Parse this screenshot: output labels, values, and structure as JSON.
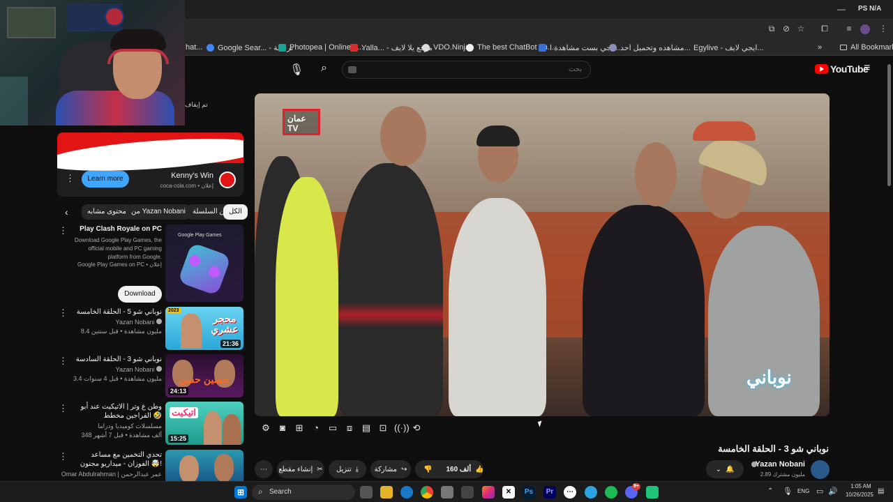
{
  "browser": {
    "bookmarks": [
      {
        "label": "hat..."
      },
      {
        "label": "Google Sear... - ترجمة"
      },
      {
        "label": "Photopea | Online P..."
      },
      {
        "label": "Yalla... - موقع يلا لايف"
      },
      {
        "label": "VDO.Ninja"
      },
      {
        "label": "The best ChatBot an..."
      },
      {
        "label": "ايجي بست مشاهدة ا..."
      },
      {
        "label": "مشاهده وتحميل احد..."
      },
      {
        "label": "Egylive - ايجي لايف..."
      }
    ],
    "all_bookmarks": "All Bookmarks",
    "titlebar_right": "PS N/A"
  },
  "youtube": {
    "logo": "YouTube",
    "search_placeholder": "بحث",
    "stop_text": "تم إيقاف"
  },
  "ad": {
    "advertiser": "Kenny's Win",
    "domain": "coca-cola.com",
    "sponsored": "إعلان",
    "cta": "Learn more"
  },
  "chips": [
    {
      "label": "الكل"
    },
    {
      "label": "من السلسلة"
    },
    {
      "label": "من Yazan Nobani"
    },
    {
      "label": "محتوى مشابه"
    }
  ],
  "promo": {
    "title": "Play Clash Royale on PC",
    "description": "Download Google Play Games, the official mobile and PC gaming platform from Google.",
    "channel": "Google Play Games on PC",
    "sponsored": "إعلان",
    "cta": "Download",
    "thumb_label": "Google Play Games"
  },
  "recommendations": [
    {
      "title": "نوباني شو 5 - الحلقة الخامسة",
      "channel": "Yazan Nobani",
      "meta": "8.4 مليون مشاهدة • قبل سنتين",
      "duration": "21:36",
      "thumb_text": "محجر عشري",
      "badge": "2023"
    },
    {
      "title": "نوباني شو 3 - الحلقة السادسة",
      "channel": "Yazan Nobani",
      "meta": "3.4 مليون مشاهدة • قبل 4 سنوات",
      "duration": "24:13",
      "thumb_text": "حسين حسن"
    },
    {
      "title": "وطن ع وتر | الاتيكيت عند أبو الفراجين مخطط 🤣",
      "channel": "مسلسلات كوميديا ودراما",
      "meta": "348 ألف مشاهدة • قبل 7 أشهر",
      "duration": "15:25",
      "thumb_text": "اتيكيت"
    },
    {
      "title": "تحدي التخمين مع مساعد الفوزان - ميداريو مجنون 🤯!",
      "channel": "Omar Abdulrahman | عمر عبدالرحمن",
      "meta": ""
    }
  ],
  "video": {
    "title": "نوباني شو 3 - الحلقة الخامسة",
    "channel": "Yazan Nobani",
    "subscribers": "2.89 مليون مشترك",
    "likes": "160 ألف",
    "share": "مشاركة",
    "download": "تنزيل",
    "clip": "إنشاء مقطع",
    "watermark_tv": "عمان TV",
    "watermark_show": "نوباني"
  },
  "taskbar": {
    "search": "Search",
    "lang": "ENG",
    "time": "1:05 AM",
    "date": "10/26/2025",
    "discord_badge": "9+"
  }
}
